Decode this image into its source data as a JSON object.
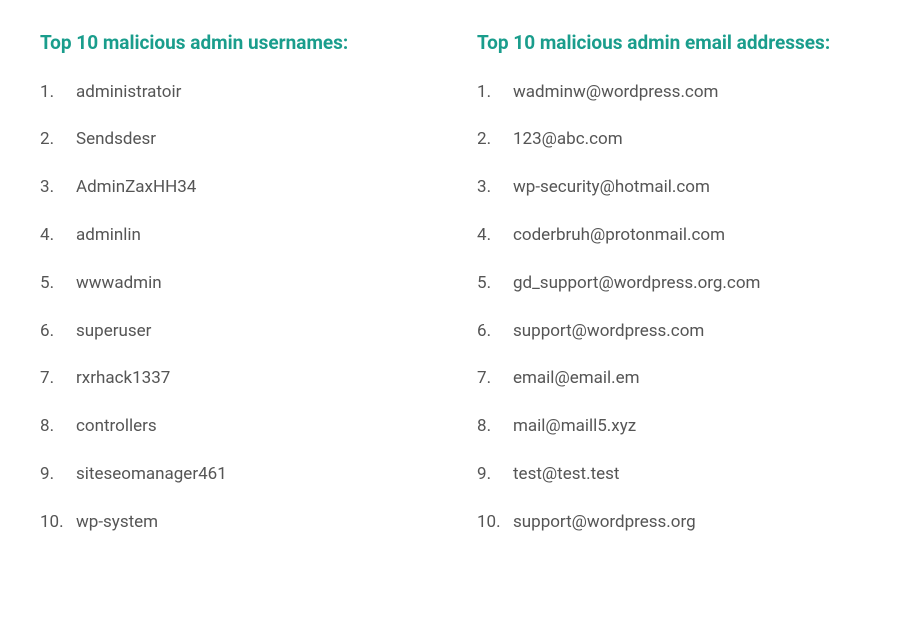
{
  "columns": [
    {
      "title": "Top 10 malicious admin usernames:",
      "items": [
        "administratoir",
        "Sendsdesr",
        "AdminZaxHH34",
        "adminlin",
        "wwwadmin",
        "superuser",
        "rxrhack1337",
        "controllers",
        "siteseomanager461",
        "wp-system"
      ]
    },
    {
      "title": "Top 10 malicious admin email addresses:",
      "items": [
        "wadminw@wordpress.com",
        "123@abc.com",
        "wp-security@hotmail.com",
        "coderbruh@protonmail.com",
        "gd_support@wordpress.org.com",
        "support@wordpress.com",
        "email@email.em",
        "mail@maill5.xyz",
        "test@test.test",
        "support@wordpress.org"
      ]
    }
  ]
}
